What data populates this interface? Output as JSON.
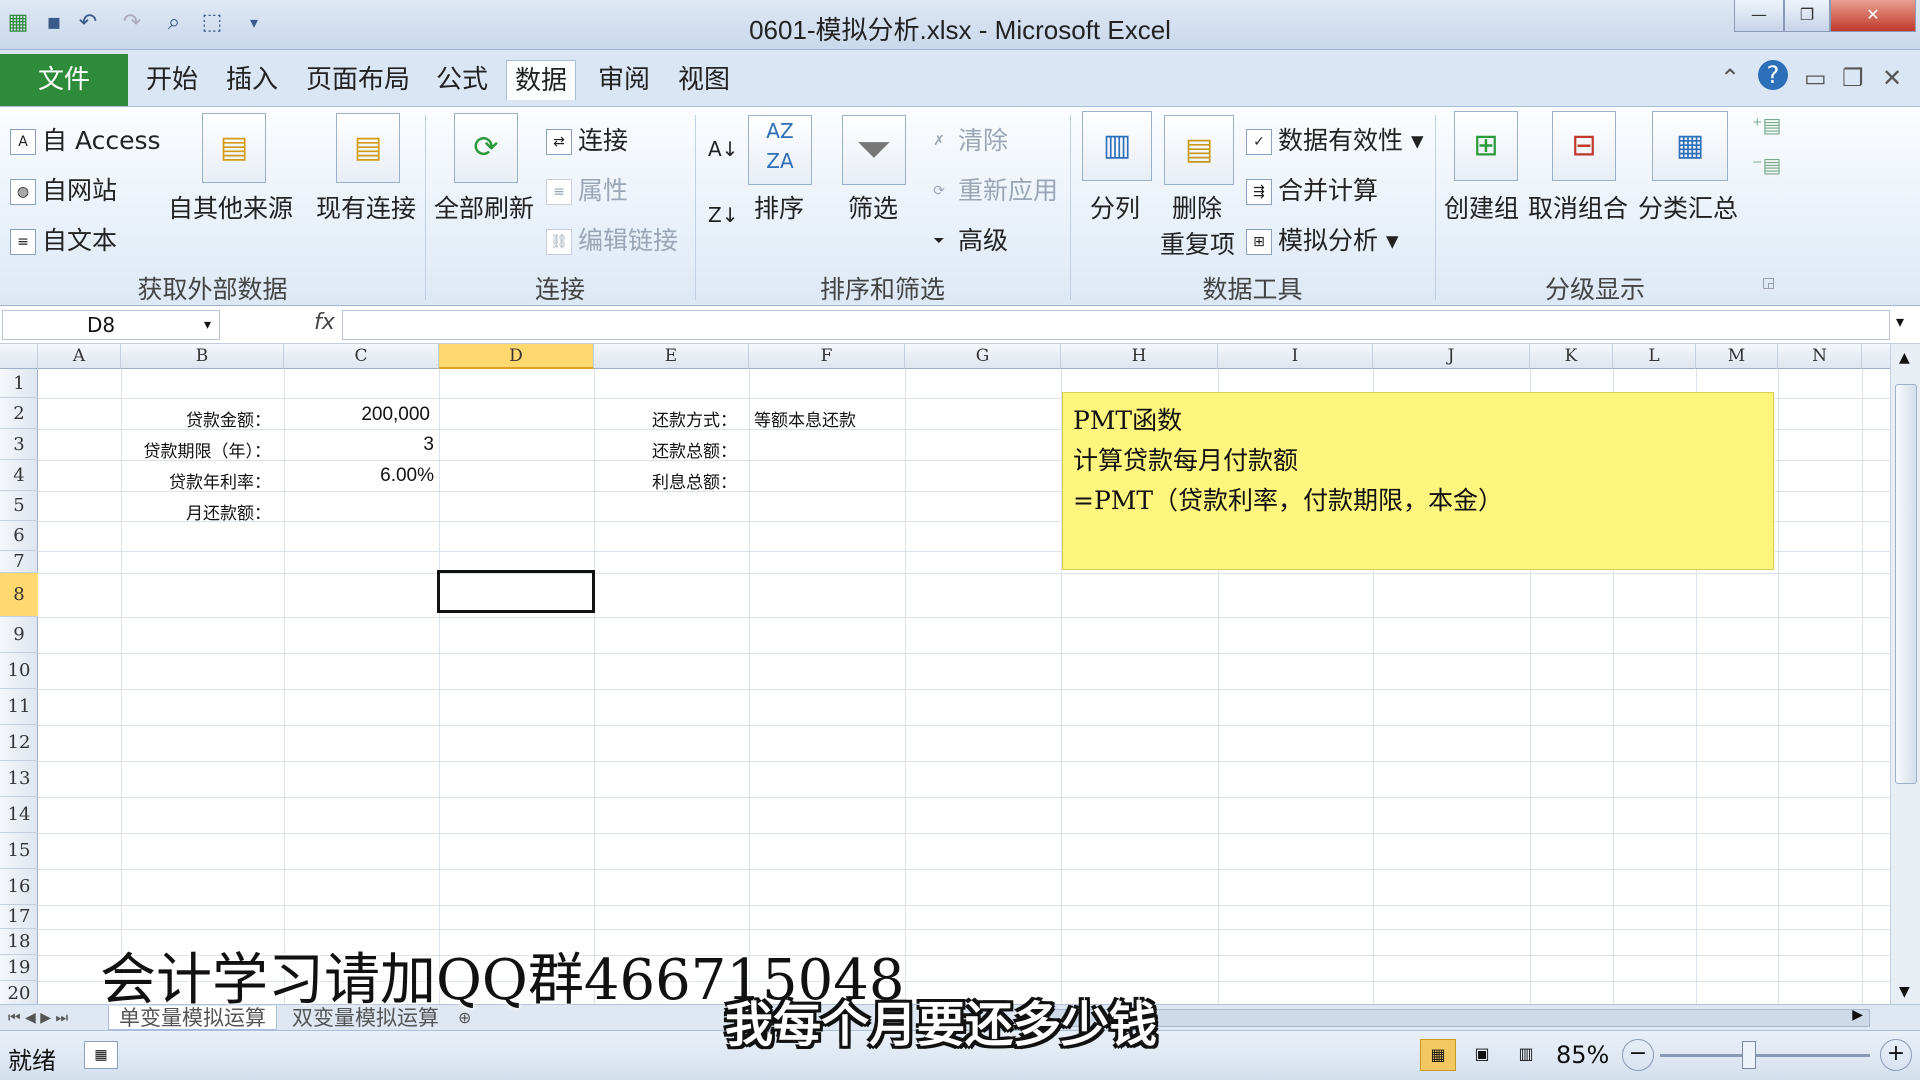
{
  "window": {
    "title": "0601-模拟分析.xlsx - Microsoft Excel"
  },
  "menu": {
    "file": "文件",
    "tabs": [
      "开始",
      "插入",
      "页面布局",
      "公式",
      "数据",
      "审阅",
      "视图"
    ],
    "active_tab": "数据"
  },
  "ribbon": {
    "external": {
      "access": "自 Access",
      "web": "自网站",
      "text": "自文本",
      "other": "自其他来源",
      "existing": "现有连接",
      "title": "获取外部数据"
    },
    "connections": {
      "refresh_all": "全部刷新",
      "connections": "连接",
      "properties": "属性",
      "edit_links": "编辑链接",
      "title": "连接"
    },
    "sort_filter": {
      "sort": "排序",
      "filter": "筛选",
      "clear": "清除",
      "reapply": "重新应用",
      "advanced": "高级",
      "title": "排序和筛选"
    },
    "data_tools": {
      "text_to_columns": "分列",
      "remove_dup_1": "删除",
      "remove_dup_2": "重复项",
      "validation": "数据有效性",
      "consolidate": "合并计算",
      "what_if": "模拟分析",
      "title": "数据工具"
    },
    "outline": {
      "group": "创建组",
      "ungroup": "取消组合",
      "subtotal": "分类汇总",
      "title": "分级显示"
    }
  },
  "formula_bar": {
    "name_box": "D8",
    "fx": "fx",
    "formula": ""
  },
  "columns": [
    "A",
    "B",
    "C",
    "D",
    "E",
    "F",
    "G",
    "H",
    "I",
    "J",
    "K",
    "L",
    "M",
    "N"
  ],
  "selected_column": "D",
  "rows": [
    "1",
    "2",
    "3",
    "4",
    "5",
    "6",
    "7",
    "8",
    "9",
    "10",
    "11",
    "12",
    "13",
    "14",
    "15",
    "16",
    "17",
    "18",
    "19",
    "20"
  ],
  "selected_row": "8",
  "cells": {
    "B2": "贷款金额：",
    "C2": "200,000",
    "B3": "贷款期限（年）：",
    "C3": "3",
    "B4": "贷款年利率：",
    "C4": "6.00%",
    "B5": "月还款额：",
    "E2": "还款方式：",
    "F2": "等额本息还款",
    "E3": "还款总额：",
    "E4": "利息总额："
  },
  "note": {
    "line1": "PMT函数",
    "line2": "计算贷款每月付款额",
    "line3": "=PMT（贷款利率，付款期限，本金）"
  },
  "sheets": [
    "单变量模拟运算",
    "双变量模拟运算"
  ],
  "status": {
    "ready": "就绪",
    "zoom": "85%"
  },
  "overlay": {
    "watermark": "会计学习请加QQ群466715048",
    "subtitle": "我每个月要还多少钱"
  }
}
